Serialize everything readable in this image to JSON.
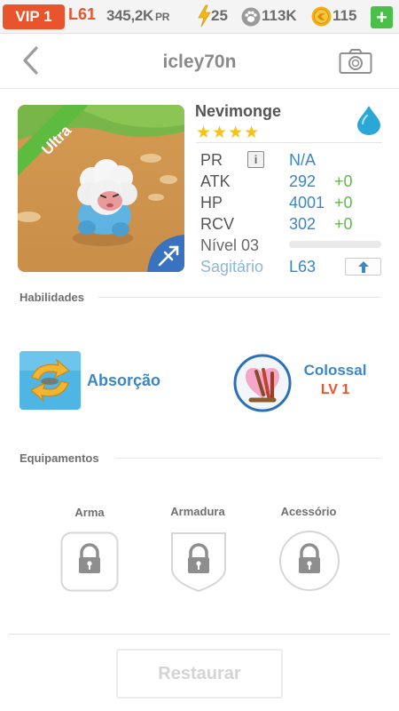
{
  "topbar": {
    "vip": "VIP 1",
    "level": "L61",
    "power": "345,2K",
    "power_label": "PR",
    "energy": "25",
    "paw_count": "113K",
    "coins": "115",
    "add_label": "+"
  },
  "header": {
    "title": "icley70n"
  },
  "monster": {
    "name": "Nevimonge",
    "rarity_banner": "Ultra",
    "stars": "★★★★",
    "star_count": 4,
    "element_icon": "water-drop-icon",
    "stats": {
      "pr_label": "PR",
      "pr_info": "i",
      "pr_value": "N/A",
      "atk_label": "ATK",
      "atk_value": "292",
      "atk_bonus": "+0",
      "hp_label": "HP",
      "hp_value": "4001",
      "hp_bonus": "+0",
      "rcv_label": "RCV",
      "rcv_value": "302",
      "rcv_bonus": "+0",
      "level_label": "Nível 03",
      "level_progress": 0,
      "zodiac_label": "Sagitário",
      "zodiac_level": "L63"
    }
  },
  "skills": {
    "section_label": "Habilidades",
    "active_name": "Absorção",
    "leader_name": "Colossal",
    "leader_level": "LV 1"
  },
  "equipment": {
    "section_label": "Equipamentos",
    "weapon_label": "Arma",
    "armor_label": "Armadura",
    "accessory_label": "Acessório"
  },
  "footer": {
    "restore_label": "Restaurar"
  },
  "colors": {
    "accent_orange": "#e8542b",
    "accent_blue": "#3a87c8",
    "bonus_green": "#5fb84a",
    "star_gold": "#f5c315",
    "ultra_green": "#5dbb3f"
  }
}
